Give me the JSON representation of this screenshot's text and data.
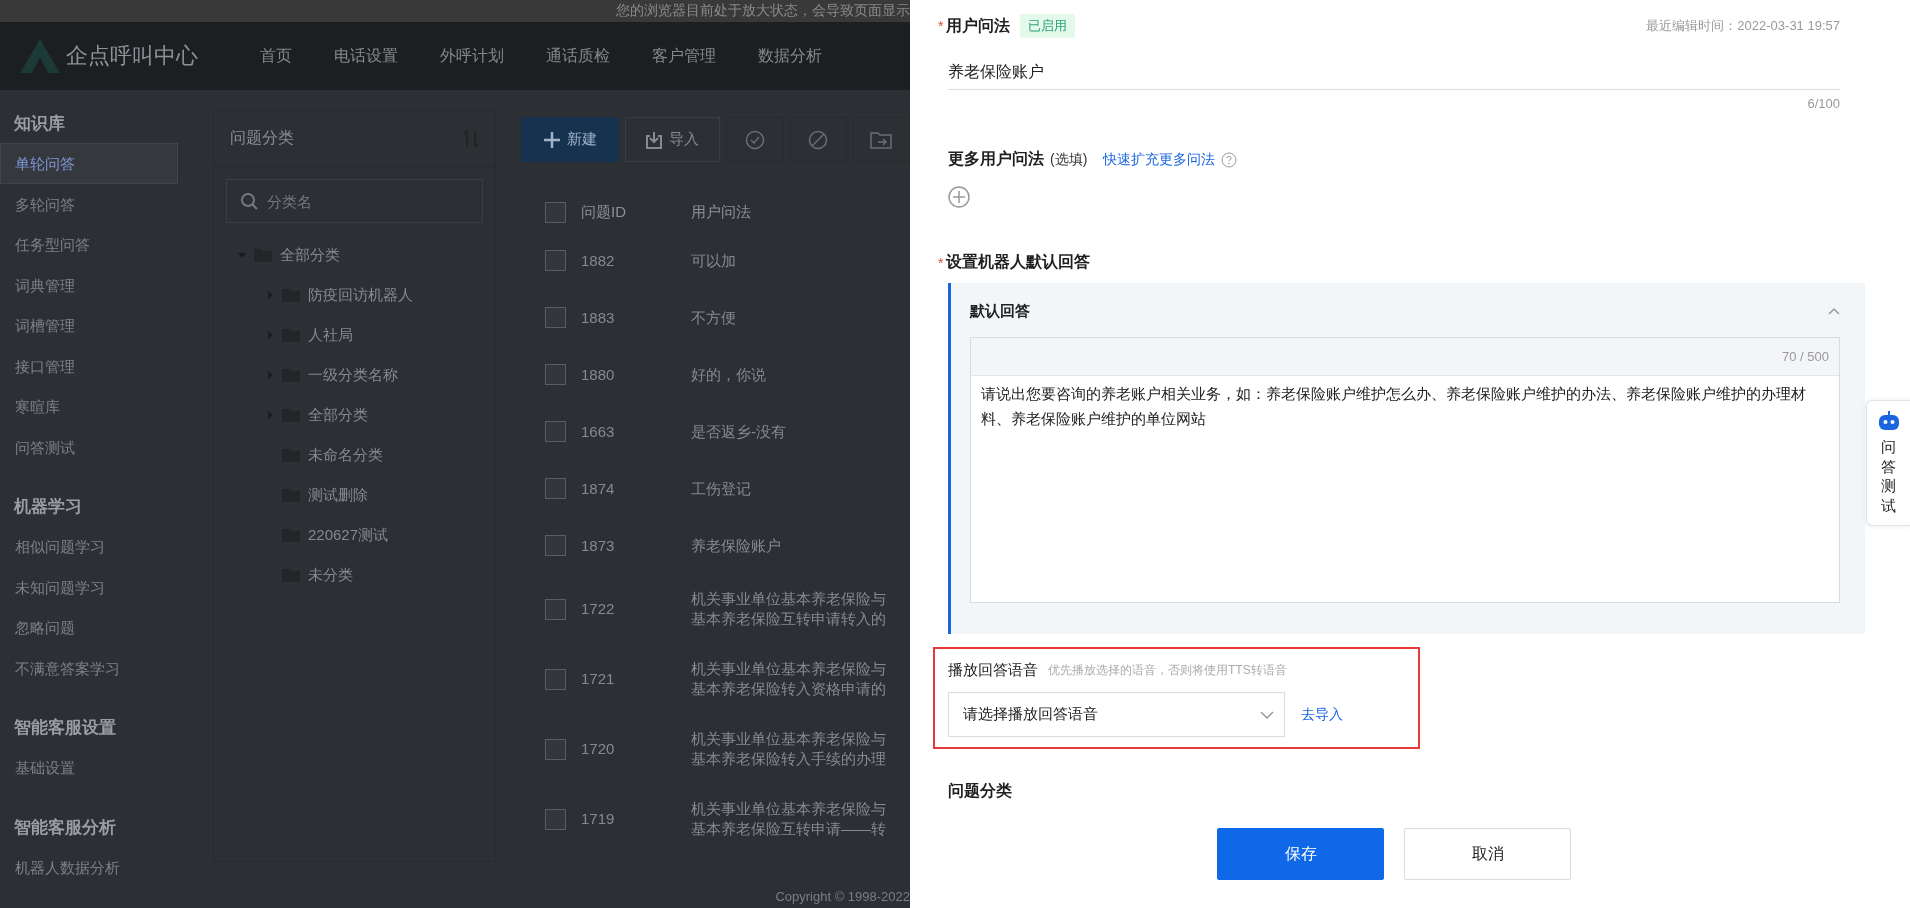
{
  "notice_bar": {
    "text": "您的浏览器目前处于放大状态，会导致页面显示"
  },
  "header": {
    "logo": "企点呼叫中心",
    "nav": [
      {
        "label": "首页",
        "selected": false
      },
      {
        "label": "电话设置",
        "selected": false
      },
      {
        "label": "外呼计划",
        "selected": false
      },
      {
        "label": "通话质检",
        "selected": false
      },
      {
        "label": "客户管理",
        "selected": false
      },
      {
        "label": "数据分析",
        "selected": false
      }
    ]
  },
  "sidebar": {
    "sections": [
      {
        "title": "知识库",
        "items": [
          {
            "label": "单轮问答",
            "selected": true
          },
          {
            "label": "多轮问答",
            "selected": false
          },
          {
            "label": "任务型问答",
            "selected": false
          },
          {
            "label": "词典管理",
            "selected": false
          },
          {
            "label": "词槽管理",
            "selected": false
          },
          {
            "label": "接口管理",
            "selected": false
          },
          {
            "label": "寒暄库",
            "selected": false
          },
          {
            "label": "问答测试",
            "selected": false
          }
        ]
      },
      {
        "title": "机器学习",
        "items": [
          {
            "label": "相似问题学习",
            "selected": false
          },
          {
            "label": "未知问题学习",
            "selected": false
          },
          {
            "label": "忽略问题",
            "selected": false
          },
          {
            "label": "不满意答案学习",
            "selected": false
          }
        ]
      },
      {
        "title": "智能客服设置",
        "items": [
          {
            "label": "基础设置",
            "selected": false
          }
        ]
      },
      {
        "title": "智能客服分析",
        "items": [
          {
            "label": "机器人数据分析",
            "selected": false
          }
        ]
      }
    ]
  },
  "category_panel": {
    "title": "问题分类",
    "search": {
      "placeholder": "分类名"
    },
    "tree": [
      {
        "label": "全部分类",
        "expanded": true,
        "children": [
          {
            "label": "防疫回访机器人",
            "expanded": false
          },
          {
            "label": "人社局",
            "expanded": false
          },
          {
            "label": "一级分类名称",
            "expanded": false
          },
          {
            "label": "全部分类",
            "expanded": false
          },
          {
            "label": "未命名分类"
          },
          {
            "label": "测试删除"
          },
          {
            "label": "220627测试"
          },
          {
            "label": "未分类"
          }
        ]
      }
    ]
  },
  "toolbar": {
    "new_button": "新建",
    "import_button": "导入"
  },
  "table": {
    "all_checked": false,
    "columns": [
      "问题ID",
      "用户问法"
    ],
    "rows": [
      {
        "checked": false,
        "id": "1882",
        "question_lines": [
          "可以加"
        ]
      },
      {
        "checked": false,
        "id": "1883",
        "question_lines": [
          "不方便"
        ]
      },
      {
        "checked": false,
        "id": "1880",
        "question_lines": [
          "好的，你说"
        ]
      },
      {
        "checked": false,
        "id": "1663",
        "question_lines": [
          "是否返乡-没有"
        ]
      },
      {
        "checked": false,
        "id": "1874",
        "question_lines": [
          "工伤登记"
        ]
      },
      {
        "checked": false,
        "id": "1873",
        "question_lines": [
          "养老保险账户"
        ]
      },
      {
        "checked": false,
        "id": "1722",
        "question_lines": [
          "机关事业单位基本养老保险与",
          "基本养老保险互转申请转入的"
        ]
      },
      {
        "checked": false,
        "id": "1721",
        "question_lines": [
          "机关事业单位基本养老保险与",
          "基本养老保险转入资格申请的"
        ]
      },
      {
        "checked": false,
        "id": "1720",
        "question_lines": [
          "机关事业单位基本养老保险与",
          "基本养老保险转入手续的办理"
        ]
      },
      {
        "checked": false,
        "id": "1719",
        "question_lines": [
          "机关事业单位基本养老保险与",
          "基本养老保险互转申请——转"
        ]
      }
    ]
  },
  "copyright": "Copyright © 1998-2022",
  "drawer": {
    "question": {
      "label": "用户问法",
      "required_mark": "*",
      "status": "已启用",
      "status_on": true,
      "edited": "最近编辑时间：2022-03-31 19:57",
      "value": "养老保险账户",
      "counter": "6/100"
    },
    "more_questions": {
      "label": "更多用户问法",
      "note": "(选填)",
      "link": "快速扩充更多问法"
    },
    "default_answer": {
      "label": "设置机器人默认回答",
      "required_mark": "*",
      "panel_title": "默认回答",
      "expanded": true,
      "counter": "70 / 500",
      "value": "请说出您要咨询的养老账户相关业务，如：养老保险账户维护怎么办、养老保险账户维护的办法、养老保险账户维护的办理材料、养老保险账户维护的单位网站"
    },
    "voice": {
      "label": "播放回答语音",
      "hint": "优先播放选择的语音，否则将使用TTS转语音",
      "placeholder": "请选择播放回答语音",
      "link": "去导入"
    },
    "category": {
      "label": "问题分类"
    },
    "buttons": [
      {
        "kind": "primary",
        "label": "保存"
      },
      {
        "kind": "default",
        "label": "取消"
      }
    ],
    "side_widget": {
      "label": "问答测试"
    }
  }
}
